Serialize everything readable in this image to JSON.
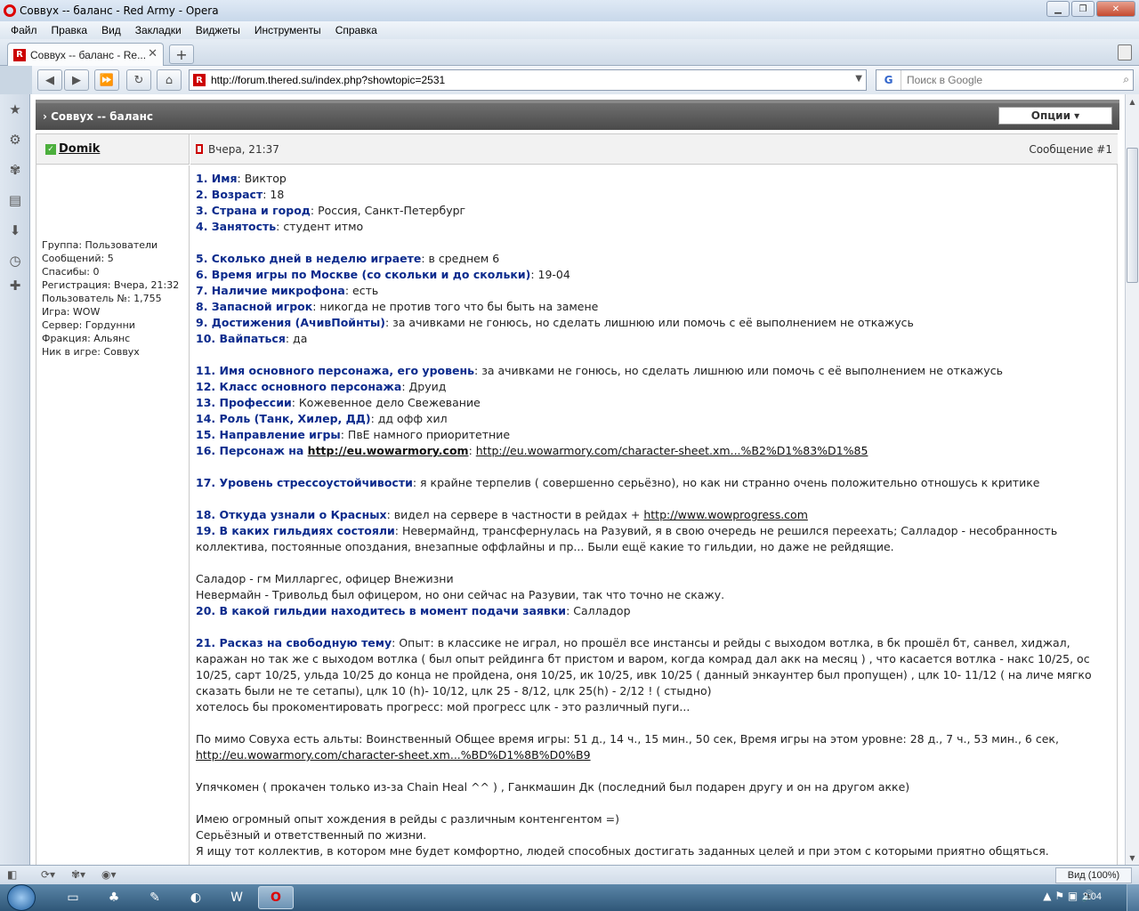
{
  "window": {
    "title": "Соввух -- баланс - Red Army - Opera"
  },
  "menu": [
    "Файл",
    "Правка",
    "Вид",
    "Закладки",
    "Виджеты",
    "Инструменты",
    "Справка"
  ],
  "tab": {
    "label": "Соввух -- баланс - Re...",
    "close": "✕"
  },
  "addressbar": {
    "url": "http://forum.thered.su/index.php?showtopic=2531"
  },
  "search": {
    "placeholder": "Поиск в Google"
  },
  "topic": {
    "title": "Соввух -- баланс",
    "options_label": "Опции"
  },
  "post": {
    "username": "Domik",
    "date": "Вчера, 21:37",
    "number": "Сообщение #1",
    "user_info": [
      "Группа: Пользователи",
      "Сообщений: 5",
      "Спасибы: 0",
      "Регистрация: Вчера, 21:32",
      "Пользователь №: 1,755",
      "Игра: WOW",
      "Сервер: Гордунни",
      "Фракция: Альянс",
      "Ник в игре: Соввух"
    ],
    "q1": "1. Имя",
    "a1": ": Виктор",
    "q2": "2. Возраст",
    "a2": ": 18",
    "q3": "3. Страна и город",
    "a3": ": Россия, Санкт-Петербург",
    "q4": "4. Занятость",
    "a4": ": студент итмо",
    "q5": "5. Сколько дней в неделю играете",
    "a5": ": в среднем 6",
    "q6": "6. Время игры по Москве (со скольки и до скольки)",
    "a6": ": 19-04",
    "q7": "7. Наличие микрофона",
    "a7": ": есть",
    "q8": "8. Запасной игрок",
    "a8": ": никогда не против того что бы быть на замене",
    "q9": "9. Достижения (АчивПойнты)",
    "a9": ": за ачивками не гонюсь, но сделать лишнюю или помочь с её выполнением не откажусь",
    "q10": "10. Вайпаться",
    "a10": ": да",
    "q11": "11. Имя основного персонажа, его уровень",
    "a11": ": за ачивками не гонюсь, но сделать лишнюю или помочь с её выполнением не откажусь",
    "q12": "12. Класс основного персонажа",
    "a12": ": Друид",
    "q13": "13. Профессии",
    "a13": ": Кожевенное дело Свежевание",
    "q14": "14. Роль (Танк, Хилер, ДД)",
    "a14": ": дд офф хил",
    "q15": "15. Направление игры",
    "a15": ": ПвЕ намного приоритетние",
    "q16": "16. Персонаж на ",
    "q16_link": "http://eu.wowarmory.com",
    "a16_sep": ": ",
    "a16_link": "http://eu.wowarmory.com/character-sheet.xm...%B2%D1%83%D1%85",
    "q17": "17. Уровень стрессоустойчивости",
    "a17": ": я крайне терпелив ( совершенно серьёзно), но как ни странно очень положительно отношусь к критике",
    "q18": "18. Откуда узнали о Красных",
    "a18": ": видел на сервере в частности в рейдах + ",
    "a18_link": "http://www.wowprogress.com",
    "q19": "19. В каких гильдиях состояли",
    "a19": ": Невермайнд, трансфернулась на Разувий, я в свою очередь не решился переехать; Салладор - несобранность коллектива, постоянные опоздания, внезапные оффлайны и пр... Были ещё какие то гильдии, но даже не рейдящие.",
    "p_sal": "Саладор - гм Милларгес, офицер Внежизни",
    "p_nev": "Невермайн - Тривольд был офицером, но они сейчас на Разувии, так что точно не скажу.",
    "q20": "20. В какой гильдии находитесь в момент подачи заявки",
    "a20": ": Салладор",
    "q21": "21. Расказ на свободную тему",
    "a21": ": Опыт: в классике не играл, но прошёл все инстансы и рейды с выходом вотлка, в бк прошёл бт, санвел, хиджал, каражан но так же с выходом вотлка ( был опыт рейдинга бт пристом и варом, когда комрад дал акк на месяц ) , что касается вотлка - накс 10/25, ос 10/25, сарт 10/25, ульда 10/25 до конца не пройдена, оня 10/25, ик 10/25, ивк 10/25 ( данный энкаунтер был пропущен) , цлк 10- 11/12 ( на личе мягко сказать были не те сетапы), цлк 10 (h)- 10/12, цлк 25 - 8/12, цлк 25(h) - 2/12 ! ( стыдно)",
    "p_prog": "хотелось бы прокоментировать прогресс: мой прогресс цлк - это различный пуги...",
    "p_alts": "По мимо Совуха есть альты: Воинственный Общее время игры: 51 д., 14 ч., 15 мин., 50 сек, Время игры на этом уровне: 28 д., 7 ч., 53 мин., 6 сек, ",
    "p_alts_link": "http://eu.wowarmory.com/character-sheet.xm...%BD%D1%8B%D0%B9",
    "p_upy": "Упячкомен ( прокачен только из-за Chain Heal ^^ ) , Ганкмашин Дк (последний был подарен другу и он на другом акке)",
    "p_exp": "Имею огромный опыт хождения в рейды с различным контенгентом =)",
    "p_ser": "Серьёзный и ответственный по жизни.",
    "p_look": "Я ищу тот коллектив, в котором мне будет комфортно, людей способных достигать заданных целей и при этом с которыми приятно общяться."
  },
  "status": {
    "zoom": "Вид (100%)"
  },
  "taskbar": {
    "clock": "2:04"
  }
}
